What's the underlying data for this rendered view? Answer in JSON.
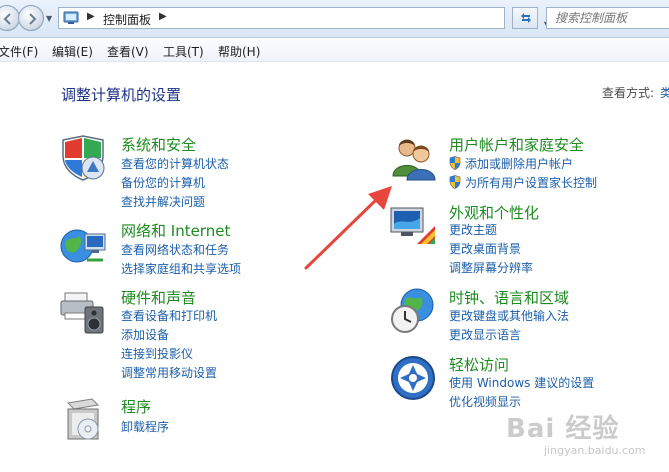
{
  "address_bar": {
    "breadcrumb": "控制面板",
    "search_placeholder": "搜索控制面板"
  },
  "menu": {
    "file": "文件(F)",
    "edit": "编辑(E)",
    "view": "查看(V)",
    "tools": "工具(T)",
    "help": "帮助(H)"
  },
  "page": {
    "title": "调整计算机的设置",
    "view_mode_label": "查看方式:",
    "view_mode_value": "类别"
  },
  "categories": [
    {
      "name": "系统和安全",
      "icon": "shield-icon",
      "links": [
        "查看您的计算机状态",
        "备份您的计算机",
        "查找并解决问题"
      ]
    },
    {
      "name": "网络和 Internet",
      "icon": "network-globe-icon",
      "links": [
        "查看网络状态和任务",
        "选择家庭组和共享选项"
      ]
    },
    {
      "name": "硬件和声音",
      "icon": "printer-speaker-icon",
      "links": [
        "查看设备和打印机",
        "添加设备",
        "连接到投影仪",
        "调整常用移动设置"
      ]
    },
    {
      "name": "程序",
      "icon": "program-box-icon",
      "links": [
        "卸载程序"
      ]
    },
    {
      "name": "用户帐户和家庭安全",
      "icon": "users-icon",
      "links": [
        "添加或删除用户帐户",
        "为所有用户设置家长控制"
      ]
    },
    {
      "name": "外观和个性化",
      "icon": "monitor-palette-icon",
      "links": [
        "更改主题",
        "更改桌面背景",
        "调整屏幕分辨率"
      ]
    },
    {
      "name": "时钟、语言和区域",
      "icon": "clock-globe-icon",
      "links": [
        "更改键盘或其他输入法",
        "更改显示语言"
      ]
    },
    {
      "name": "轻松访问",
      "icon": "accessibility-icon",
      "links": [
        "使用 Windows 建议的设置",
        "优化视频显示"
      ]
    }
  ],
  "watermark": {
    "text": "Bai 经验",
    "sub": "jingyan.baidu.com"
  },
  "colors": {
    "heading_green": "#1e8a22",
    "link_blue": "#1d5fa8",
    "title_blue": "#1e3287",
    "arrow_red": "#e8453c"
  }
}
